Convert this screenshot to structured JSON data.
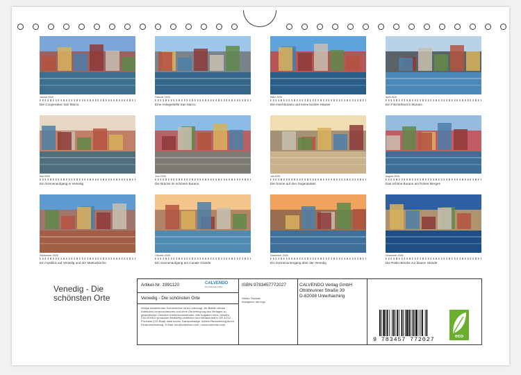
{
  "title_lines": [
    "Venedig - Die",
    "schönsten Orte"
  ],
  "months": [
    {
      "month": "Januar 2026",
      "caption": "Die Cooperative San Marco",
      "sky": "#7aa7d8",
      "mid": "#a84a3a",
      "water": "#3d6f8e"
    },
    {
      "month": "Februar 2026",
      "caption": "Eine Anlegestelle San Marco",
      "sky": "#9ec6ea",
      "mid": "#6c6c6c",
      "water": "#35678c"
    },
    {
      "month": "März 2026",
      "caption": "Die Insel Burano und seine bunten Häuser",
      "sky": "#5fa3dc",
      "mid": "#d33b2c",
      "water": "#2a5e88"
    },
    {
      "month": "April 2026",
      "caption": "Ein Fischerboot in Burano",
      "sky": "#b9d2e6",
      "mid": "#3e3e3e",
      "water": "#4c88b8"
    },
    {
      "month": "Mai 2026",
      "caption": "Ein Sonnenaufgang in Venedig",
      "sky": "#e7d7c2",
      "mid": "#b5624a",
      "water": "#4f6f7c"
    },
    {
      "month": "Juni 2026",
      "caption": "Die Brücke im schönen Burano",
      "sky": "#8cbbe5",
      "mid": "#c6463a",
      "water": "#7d7a74"
    },
    {
      "month": "Juli 2026",
      "caption": "Die Sonne auf den Dogenpalast",
      "sky": "#f0ddb4",
      "mid": "#8c7760",
      "water": "#c9b18c"
    },
    {
      "month": "August 2026",
      "caption": "Das schöne Burano am frühen Morgen",
      "sky": "#96bde0",
      "mid": "#cf3b3b",
      "water": "#3d6e95"
    },
    {
      "month": "September 2026",
      "caption": "Ein Ausblick auf Venedig und der Markuskirche",
      "sky": "#5f9ad3",
      "mid": "#b66a4a",
      "water": "#a35e46"
    },
    {
      "month": "Oktober 2026",
      "caption": "Ein Sonnenaufgang am Canale Grande",
      "sky": "#f3c58a",
      "mid": "#9c6e5a",
      "water": "#4f8bb0"
    },
    {
      "month": "November 2026",
      "caption": "Ein Sonnenuntergang über der Venedig",
      "sky": "#f1a35e",
      "mid": "#7a5b4c",
      "water": "#3f6f9b"
    },
    {
      "month": "Dezember 2026",
      "caption": "Die Rialto-Brücke zur blauen Stunde",
      "sky": "#2f5fa3",
      "mid": "#d9a45c",
      "water": "#1f4e86"
    }
  ],
  "info": {
    "artikel": "Artikel-Nr. 1991120",
    "calvendo_logo": "CALVENDO",
    "calvendo_sub": "Die Kalendermarke",
    "product_title": "Venedig - Die schönsten Orte",
    "isbn": "ISBN 9783457772027",
    "publisher": [
      "CALVENDO Verlag GmbH",
      "Ottobrunner Straße 39",
      "D-82008 Unterhaching"
    ],
    "author": [
      "Stefan Tewinan",
      "Instagram: lae.logo"
    ],
    "legal": "Infolge bestehender Schutzrechte ist es untersagt, die Blätter dieses Kalenders herauszutrennen und ohne Genehmigung des Verlages zu gewerblichen Zwecken weiterzuverwenden. Alle Angaben ohne Gewähr. CALVENDO produziert beidseitig zertifiziert und klimaneutral in DE & EU Produkte (OG-Blatt) dank kurzer Transportwege. Aktiver Reduzierung durch Eindruckerhaltung. E-Mail: info@calvendo.com • www.calvendo.com",
    "barcode_number": "9 783457 772027",
    "eco_label": "eco"
  }
}
